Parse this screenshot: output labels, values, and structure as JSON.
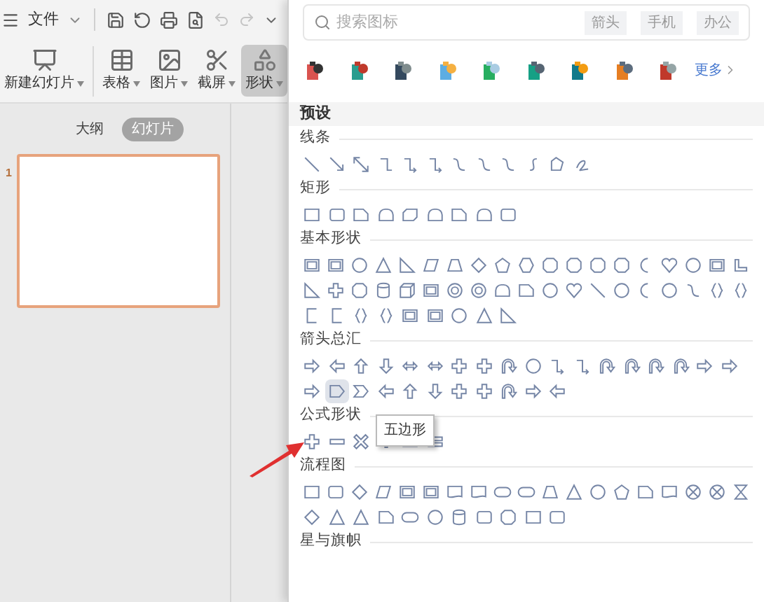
{
  "menu": {
    "label": "文件"
  },
  "ribbon": [
    {
      "label": "新建幻灯片",
      "selected": false
    },
    {
      "label": "表格",
      "selected": false
    },
    {
      "label": "图片",
      "selected": false
    },
    {
      "label": "截屏",
      "selected": false
    },
    {
      "label": "形状",
      "selected": true
    }
  ],
  "pane_tabs": [
    {
      "label": "大纲",
      "selected": false
    },
    {
      "label": "幻灯片",
      "selected": true
    }
  ],
  "slides": [
    {
      "number": "1",
      "selected": true
    }
  ],
  "shapes_panel": {
    "search": {
      "placeholder": "搜索图标"
    },
    "tags": [
      "箭头",
      "手机",
      "办公"
    ],
    "more": "更多",
    "preset": "预设",
    "sections": [
      {
        "title": "线条",
        "rows": [
          [
            {
              "hovered": false
            },
            {
              "hovered": false
            },
            {
              "hovered": false
            },
            {
              "hovered": false
            },
            {
              "hovered": false
            },
            {
              "hovered": false
            },
            {
              "hovered": false
            },
            {
              "hovered": false
            },
            {
              "hovered": false
            },
            {
              "hovered": false
            },
            {
              "hovered": false
            },
            {
              "hovered": false
            }
          ]
        ]
      },
      {
        "title": "矩形",
        "rows": [
          [
            {
              "hovered": false
            },
            {
              "hovered": false
            },
            {
              "hovered": false
            },
            {
              "hovered": false
            },
            {
              "hovered": false
            },
            {
              "hovered": false
            },
            {
              "hovered": false
            },
            {
              "hovered": false
            },
            {
              "hovered": false
            }
          ]
        ]
      },
      {
        "title": "基本形状",
        "rows": [
          [
            {
              "hovered": false
            },
            {
              "hovered": false
            },
            {
              "hovered": false
            },
            {
              "hovered": false
            },
            {
              "hovered": false
            },
            {
              "hovered": false
            },
            {
              "hovered": false
            },
            {
              "hovered": false
            },
            {
              "hovered": false
            },
            {
              "hovered": false
            },
            {
              "hovered": false
            },
            {
              "hovered": false
            },
            {
              "hovered": false
            },
            {
              "hovered": false
            },
            {
              "hovered": false
            },
            {
              "hovered": false
            },
            {
              "hovered": false
            },
            {
              "hovered": false
            },
            {
              "hovered": false
            }
          ],
          [
            {
              "hovered": false
            },
            {
              "hovered": false
            },
            {
              "hovered": false
            },
            {
              "hovered": false
            },
            {
              "hovered": false
            },
            {
              "hovered": false
            },
            {
              "hovered": false
            },
            {
              "hovered": false
            },
            {
              "hovered": false
            },
            {
              "hovered": false
            },
            {
              "hovered": false
            },
            {
              "hovered": false
            },
            {
              "hovered": false
            },
            {
              "hovered": false
            },
            {
              "hovered": false
            },
            {
              "hovered": false
            },
            {
              "hovered": false
            },
            {
              "hovered": false
            },
            {
              "hovered": false
            }
          ],
          [
            {
              "hovered": false
            },
            {
              "hovered": false
            },
            {
              "hovered": false
            },
            {
              "hovered": false
            },
            {
              "hovered": false
            },
            {
              "hovered": false
            },
            {
              "hovered": false
            },
            {
              "hovered": false
            },
            {
              "hovered": false
            }
          ]
        ]
      },
      {
        "title": "箭头总汇",
        "rows": [
          [
            {
              "hovered": false
            },
            {
              "hovered": false
            },
            {
              "hovered": false
            },
            {
              "hovered": false
            },
            {
              "hovered": false
            },
            {
              "hovered": false
            },
            {
              "hovered": false
            },
            {
              "hovered": false
            },
            {
              "hovered": false
            },
            {
              "hovered": false
            },
            {
              "hovered": false
            },
            {
              "hovered": false
            },
            {
              "hovered": false
            },
            {
              "hovered": false
            },
            {
              "hovered": false
            },
            {
              "hovered": false
            },
            {
              "hovered": false
            },
            {
              "hovered": false
            }
          ],
          [
            {
              "hovered": false
            },
            {
              "hovered": true
            },
            {
              "hovered": false
            },
            {
              "hovered": false
            },
            {
              "hovered": false
            },
            {
              "hovered": false
            },
            {
              "hovered": false
            },
            {
              "hovered": false
            },
            {
              "hovered": false
            },
            {
              "hovered": false
            },
            {
              "hovered": false
            }
          ]
        ]
      },
      {
        "title": "公式形状",
        "rows": [
          [
            {
              "hovered": false
            },
            {
              "hovered": false
            },
            {
              "hovered": false
            },
            {
              "hovered": false
            },
            {
              "hovered": false
            },
            {
              "hovered": false
            }
          ]
        ]
      },
      {
        "title": "流程图",
        "rows": [
          [
            {
              "hovered": false
            },
            {
              "hovered": false
            },
            {
              "hovered": false
            },
            {
              "hovered": false
            },
            {
              "hovered": false
            },
            {
              "hovered": false
            },
            {
              "hovered": false
            },
            {
              "hovered": false
            },
            {
              "hovered": false
            },
            {
              "hovered": false
            },
            {
              "hovered": false
            },
            {
              "hovered": false
            },
            {
              "hovered": false
            },
            {
              "hovered": false
            },
            {
              "hovered": false
            },
            {
              "hovered": false
            },
            {
              "hovered": false
            },
            {
              "hovered": false
            },
            {
              "hovered": false
            }
          ],
          [
            {
              "hovered": false
            },
            {
              "hovered": false
            },
            {
              "hovered": false
            },
            {
              "hovered": false
            },
            {
              "hovered": false
            },
            {
              "hovered": false
            },
            {
              "hovered": false
            },
            {
              "hovered": false
            },
            {
              "hovered": false
            },
            {
              "hovered": false
            },
            {
              "hovered": false
            }
          ]
        ]
      },
      {
        "title": "星与旗帜"
      }
    ],
    "tooltip": {
      "text": "五边形"
    }
  }
}
